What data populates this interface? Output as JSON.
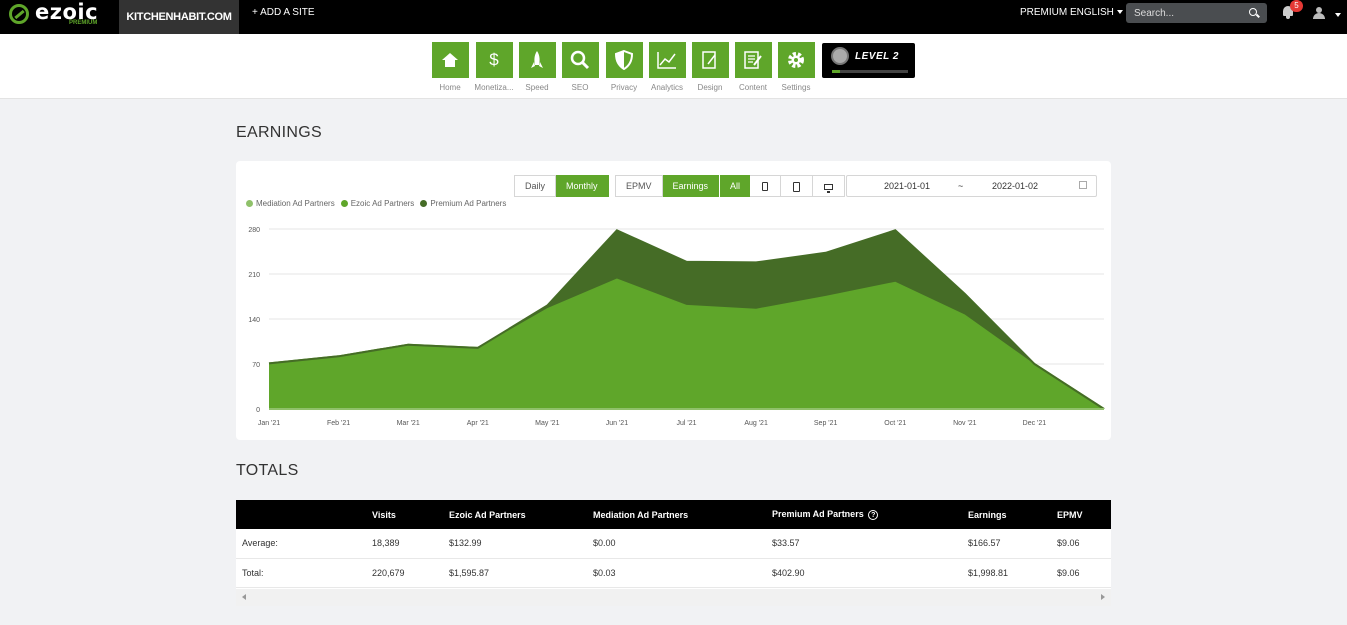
{
  "topbar": {
    "logo": "ezoic",
    "logo_sub": "PREMIUM",
    "site": "KITCHENHABIT.COM",
    "add_site": "+ ADD A SITE",
    "premium": "PREMIUM",
    "language": "ENGLISH",
    "search_placeholder": "Search...",
    "notifications": "5"
  },
  "nav": {
    "items": [
      {
        "label": "Home",
        "icon": "home-icon"
      },
      {
        "label": "Monetiza...",
        "icon": "dollar-icon"
      },
      {
        "label": "Speed",
        "icon": "rocket-icon"
      },
      {
        "label": "SEO",
        "icon": "magnifier-icon"
      },
      {
        "label": "Privacy",
        "icon": "shield-icon"
      },
      {
        "label": "Analytics",
        "icon": "line-chart-icon"
      },
      {
        "label": "Design",
        "icon": "design-icon"
      },
      {
        "label": "Content",
        "icon": "document-icon"
      },
      {
        "label": "Settings",
        "icon": "gear-icon"
      }
    ],
    "level": "LEVEL 2",
    "level_progress": 0.1
  },
  "earnings": {
    "title": "EARNINGS",
    "period_buttons": [
      "Daily",
      "Monthly"
    ],
    "active_period": "Monthly",
    "metric_buttons": [
      "EPMV",
      "Earnings"
    ],
    "active_metric": "Earnings",
    "device_all": "All",
    "date_from": "2021-01-01",
    "date_sep": "~",
    "date_to": "2022-01-02"
  },
  "chart_data": {
    "type": "area",
    "categories": [
      "Jan '21",
      "Feb '21",
      "Mar '21",
      "Apr '21",
      "May '21",
      "Jun '21",
      "Jul '21",
      "Aug '21",
      "Sep '21",
      "Oct '21",
      "Nov '21",
      "Dec '21",
      ""
    ],
    "yticks": [
      0,
      70,
      140,
      210,
      280
    ],
    "ylim": [
      0,
      280
    ],
    "stacked": true,
    "legend_position": "top-left",
    "series": [
      {
        "name": "Mediation Ad Partners",
        "color": "#8fc16a",
        "values": [
          0,
          0,
          0,
          0,
          0,
          0,
          0,
          0,
          0,
          0,
          0,
          0,
          0
        ]
      },
      {
        "name": "Ezoic Ad Partners",
        "color": "#5fa62a",
        "values": [
          71,
          82,
          100,
          95,
          157,
          203,
          162,
          156,
          176,
          198,
          147,
          70,
          0
        ]
      },
      {
        "name": "Premium Ad Partners",
        "color": "#456c26",
        "values": [
          0,
          0,
          0,
          0,
          4,
          75,
          67,
          72,
          67,
          80,
          32,
          0,
          0
        ]
      }
    ]
  },
  "totals": {
    "title": "TOTALS",
    "headers": [
      "",
      "Visits",
      "Ezoic Ad Partners",
      "Mediation Ad Partners",
      "Premium Ad Partners",
      "Earnings",
      "EPMV"
    ],
    "rows": [
      [
        "Average:",
        "18,389",
        "$132.99",
        "$0.00",
        "$33.57",
        "$166.57",
        "$9.06"
      ],
      [
        "Total:",
        "220,679",
        "$1,595.87",
        "$0.03",
        "$402.90",
        "$1,998.81",
        "$9.06"
      ]
    ]
  }
}
